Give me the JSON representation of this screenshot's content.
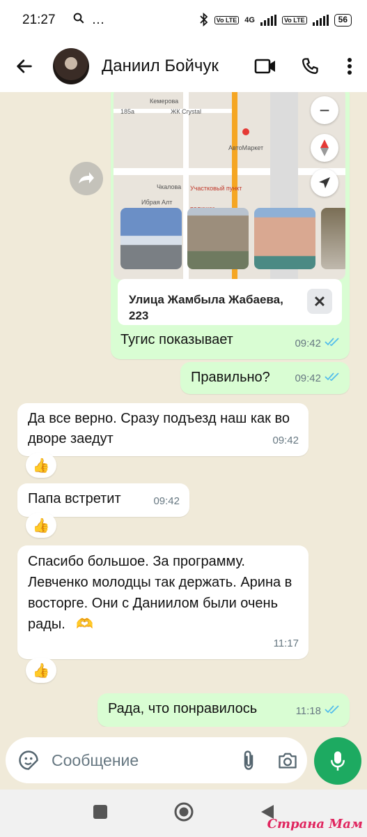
{
  "status_bar": {
    "time": "21:27",
    "search_icon": "search-icon",
    "more": "…",
    "volte1": "Vo LTE",
    "network": "4G",
    "volte2": "Vo LTE",
    "battery": "56"
  },
  "header": {
    "contact_name": "Даниил Бойчук",
    "icons": [
      "back-arrow-icon",
      "video-call-icon",
      "phone-icon",
      "more-vertical-icon"
    ]
  },
  "messages": [
    {
      "type": "location",
      "direction": "out",
      "map_labels": [
        "185а",
        "ЖК Crystal",
        "Кемерова",
        "АвтоМаркет",
        "Чкалова",
        "Участковый пункт полиции",
        "Ибрая Алт"
      ],
      "address": "Улица Жамбыла Жабаева, 223",
      "caption": "Тугис показывает",
      "time": "09:42",
      "status": "read"
    },
    {
      "direction": "out",
      "text": "Правильно?",
      "time": "09:42",
      "status": "read"
    },
    {
      "direction": "in",
      "text": "Да все верно. Сразу подъезд наш как во дворе заедут",
      "time": "09:42",
      "reaction": "👍"
    },
    {
      "direction": "in",
      "text": "Папа встретит",
      "time": "09:42",
      "reaction": "👍"
    },
    {
      "direction": "in",
      "text": "Спасибо большое. За программу. Левченко молодцы так держать. Арина в восторге.   Они с Даниилом были очень рады.",
      "emoji": "🫶",
      "time": "11:17",
      "reaction": "👍"
    },
    {
      "direction": "out",
      "text": "Рада, что понравилось",
      "time": "11:18",
      "status": "read"
    }
  ],
  "input": {
    "placeholder": "Сообщение",
    "icons": [
      "sticker-icon",
      "attach-icon",
      "camera-icon",
      "mic-icon"
    ]
  },
  "nav": {
    "icons": [
      "recent-apps-icon",
      "home-icon",
      "back-icon"
    ]
  },
  "watermark": "Страна Мам",
  "colors": {
    "outgoing": "#d9fdd3",
    "incoming": "#ffffff",
    "read_ticks": "#53bdeb",
    "mic": "#1daa61"
  }
}
